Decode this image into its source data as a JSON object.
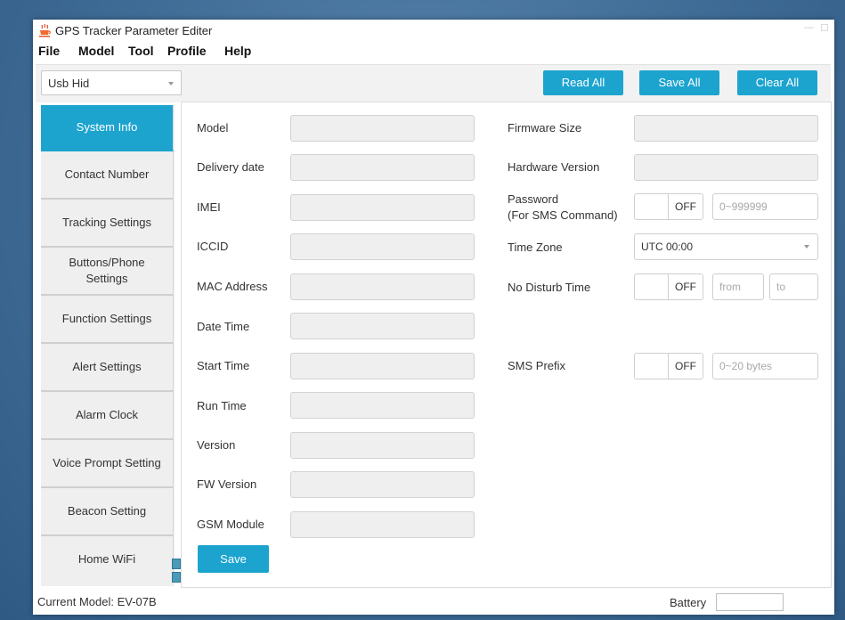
{
  "window": {
    "title": "GPS Tracker Parameter Editer",
    "icon": "cup-icon",
    "accent_color": "#1ca4cf"
  },
  "menu": [
    "File",
    "Model",
    "Tool",
    "Profile",
    "Help"
  ],
  "toolbar": {
    "device": "Usb Hid",
    "read_all": "Read All",
    "save_all": "Save All",
    "clear_all": "Clear All"
  },
  "sidebar": {
    "items": [
      "System Info",
      "Contact Number",
      "Tracking Settings",
      "Buttons/Phone Settings",
      "Function Settings",
      "Alert Settings",
      "Alarm Clock",
      "Voice Prompt Setting",
      "Beacon Setting",
      "Home WiFi"
    ],
    "active": "System Info"
  },
  "system_info": {
    "left_fields": [
      "Model",
      "Delivery date",
      "IMEI",
      "ICCID",
      "MAC Address",
      "Date Time",
      "Start Time",
      "Run Time",
      "Version",
      "FW Version",
      "GSM Module"
    ],
    "save_button": "Save"
  },
  "right_panel": {
    "firmware_size": "Firmware Size",
    "hardware_version": "Hardware Version",
    "password_label_1": "Password",
    "password_label_2": "(For SMS Command)",
    "password_toggle": "OFF",
    "password_placeholder": "0~999999",
    "time_zone_label": "Time Zone",
    "time_zone_value": "UTC 00:00",
    "no_disturb_label": "No Disturb Time",
    "no_disturb_toggle": "OFF",
    "from_placeholder": "from",
    "to_placeholder": "to",
    "sms_prefix_label": "SMS Prefix",
    "sms_prefix_toggle": "OFF",
    "sms_prefix_placeholder": "0~20 bytes"
  },
  "status": {
    "current_model": "Current Model: EV-07B",
    "battery_label": "Battery"
  }
}
